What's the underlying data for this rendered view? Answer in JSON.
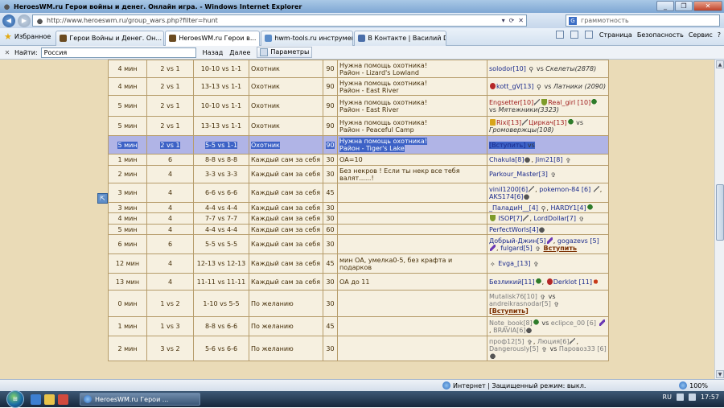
{
  "window": {
    "title": "HeroesWM.ru Герои войны и денег. Онлайн игра. - Windows Internet Explorer",
    "controls": [
      "_",
      "❐",
      "✕"
    ]
  },
  "address": {
    "url": "http://www.heroeswm.ru/group_wars.php?filter=hunt",
    "buttons": [
      "▾",
      "⟳",
      "✕"
    ]
  },
  "search": {
    "placeholder": "граммотность"
  },
  "favorites": {
    "label": "Избранное"
  },
  "tabs": [
    {
      "label": "Герои Войны и Денег. Он...",
      "active": false
    },
    {
      "label": "HeroesWM.ru Герои в...",
      "active": true
    },
    {
      "label": "hwm-tools.ru инструмент...",
      "active": false
    },
    {
      "label": "В Контакте | Василий Des...",
      "active": false
    }
  ],
  "commands": {
    "page": "Страница",
    "security": "Безопасность",
    "service": "Сервис",
    "help": "?"
  },
  "find": {
    "label": "Найти:",
    "value": "Россия",
    "back": "Назад",
    "next": "Далее",
    "params": "Параметры"
  },
  "colors": {
    "page_bg": "#eadbb7",
    "cell_bg": "#f6f0e0",
    "border": "#b69c6a",
    "highlight": "#b0b4e6"
  },
  "rows": [
    {
      "time": "4 мин",
      "fmt": "2 vs 1",
      "lvl": "10-10 vs 1-1",
      "type": "Охотник",
      "n": "90",
      "desc": "Нужна помощь охотника!\nРайон - Lizard's Lowland"
    },
    {
      "time": "4 мин",
      "fmt": "2 vs 1",
      "lvl": "13-13 vs 1-1",
      "type": "Охотник",
      "n": "90",
      "desc": "Нужна помощь охотника!\nРайон - East River"
    },
    {
      "time": "5 мин",
      "fmt": "2 vs 1",
      "lvl": "10-10 vs 1-1",
      "type": "Охотник",
      "n": "90",
      "desc": "Нужна помощь охотника!\nРайон - East River"
    },
    {
      "time": "5 мин",
      "fmt": "2 vs 1",
      "lvl": "13-13 vs 1-1",
      "type": "Охотник",
      "n": "90",
      "desc": "Нужна помощь охотника!\nРайон - Peaceful Camp"
    },
    {
      "time": "5 мин",
      "fmt": "2 vs 1",
      "lvl": "5-5 vs 1-1",
      "type": "Охотник",
      "n": "90",
      "desc": "Нужна помощь охотника!\nРайон - Tiger's Lake"
    },
    {
      "time": "1 мин",
      "fmt": "6",
      "lvl": "8-8 vs 8-8",
      "type": "Каждый сам за себя",
      "n": "30",
      "desc": "ОА=10"
    },
    {
      "time": "2 мин",
      "fmt": "4",
      "lvl": "3-3 vs 3-3",
      "type": "Каждый сам за себя",
      "n": "30",
      "desc": "Без некров ! Если ты некр все тебя валят......!"
    },
    {
      "time": "3 мин",
      "fmt": "4",
      "lvl": "6-6 vs 6-6",
      "type": "Каждый сам за себя",
      "n": "45",
      "desc": ""
    },
    {
      "time": "3 мин",
      "fmt": "4",
      "lvl": "4-4 vs 4-4",
      "type": "Каждый сам за себя",
      "n": "30",
      "desc": ""
    },
    {
      "time": "4 мин",
      "fmt": "4",
      "lvl": "7-7 vs 7-7",
      "type": "Каждый сам за себя",
      "n": "30",
      "desc": ""
    },
    {
      "time": "5 мин",
      "fmt": "4",
      "lvl": "4-4 vs 4-4",
      "type": "Каждый сам за себя",
      "n": "60",
      "desc": ""
    },
    {
      "time": "6 мин",
      "fmt": "6",
      "lvl": "5-5 vs 5-5",
      "type": "Каждый сам за себя",
      "n": "30",
      "desc": ""
    },
    {
      "time": "12 мин",
      "fmt": "4",
      "lvl": "12-13 vs 12-13",
      "type": "Каждый сам за себя",
      "n": "45",
      "desc": "мин ОА, умелка0-5, без крафта и подарков"
    },
    {
      "time": "13 мин",
      "fmt": "4",
      "lvl": "11-11 vs 11-11",
      "type": "Каждый сам за себя",
      "n": "30",
      "desc": "ОА до 11"
    },
    {
      "time": "0 мин",
      "fmt": "1 vs 2",
      "lvl": "1-10 vs 5-5",
      "type": "По желанию",
      "n": "30",
      "desc": ""
    },
    {
      "time": "1 мин",
      "fmt": "1 vs 3",
      "lvl": "8-8 vs 6-6",
      "type": "По желанию",
      "n": "45",
      "desc": ""
    },
    {
      "time": "2 мин",
      "fmt": "3 vs 2",
      "lvl": "5-6 vs 6-6",
      "type": "По желанию",
      "n": "30",
      "desc": ""
    }
  ],
  "players": {
    "r0": {
      "p1": "solodor[10]",
      "vs": "vs",
      "e1": "Скелеты(2878)"
    },
    "r1": {
      "p1": "kott_gV[13]",
      "vs": "vs",
      "e1": "Латники (2090)"
    },
    "r2": {
      "p1": "Engsetter[10]",
      "p2": "Real_girl [10]",
      "vs": "vs",
      "e1": "Мятежники(3323)"
    },
    "r3": {
      "p1": "Rixi[13]",
      "p2": "Циркач[13]",
      "vs": "vs",
      "e1": "Громовержцы(108)"
    },
    "r4": {
      "join": "[Вступить]",
      "vs": "vs"
    },
    "r5": {
      "p1": "Chakula[8]",
      "p2": "Jim21[8]"
    },
    "r6": {
      "p1": "Parkour_Master[3]"
    },
    "r7": {
      "p1": "vinil1200[6]",
      "p2": "pokemon-84 [6]",
      "p3": "AKS174[6]"
    },
    "r8": {
      "p1": "_ПаладиН__[4]",
      "p2": "HARDY1[4]"
    },
    "r9": {
      "p1": "ISOP[7]",
      "p2": "LordDollar[7]"
    },
    "r10": {
      "p1": "PerfectWorls[4]"
    },
    "r11": {
      "p1": "Добрый-Джин[5]",
      "p2": "gogazevs [5]",
      "p3": "fulgard[5]",
      "join": "Вступить"
    },
    "r12": {
      "p1": "Evga_[13]"
    },
    "r13": {
      "p1": "Безликий[11]",
      "p2": "Derklot [11]"
    },
    "r14": {
      "p1": "Mutalisk76[10]",
      "vs": "vs",
      "p2": "andreikrasnodar[5]",
      "join": "[Вступить]"
    },
    "r15": {
      "p1": "Note_book[8]",
      "vs": "vs",
      "p2": "eclipce_00 [6]",
      "p3": "BRAVIA[6]"
    },
    "r16": {
      "p1": "проф12[5]",
      "p2": "Люция[6]",
      "p3": "Dangerously[5]",
      "vs": "vs",
      "p4": "Паровоз33 [6]"
    }
  },
  "status": {
    "text": "Интернет | Защищенный режим: выкл.",
    "zoom": "100%"
  },
  "taskbar": {
    "window": "HeroesWM.ru Герои ...",
    "lang": "RU",
    "clock": "17:57"
  }
}
